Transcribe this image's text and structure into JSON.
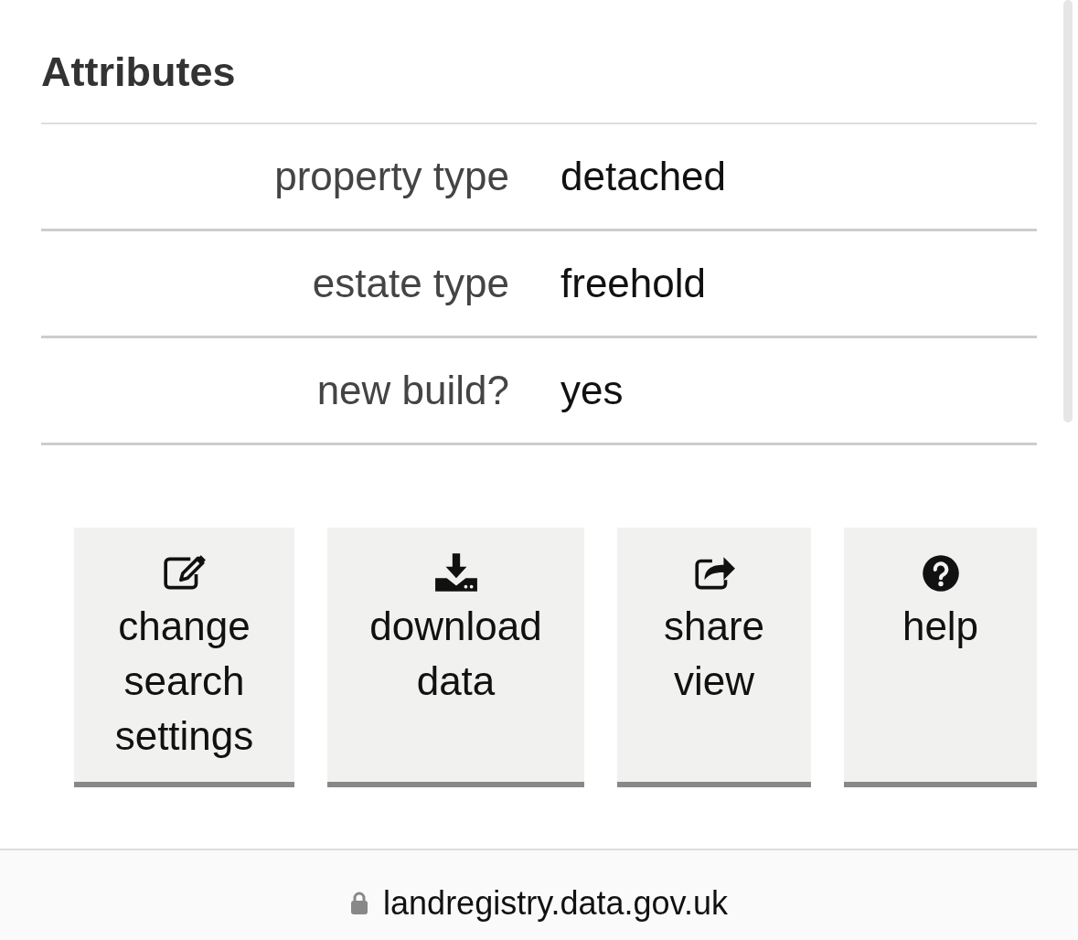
{
  "section": {
    "title": "Attributes"
  },
  "attributes": [
    {
      "label": "property type",
      "value": "detached"
    },
    {
      "label": "estate type",
      "value": "freehold"
    },
    {
      "label": "new build?",
      "value": "yes"
    }
  ],
  "buttons": [
    {
      "kind": "edit",
      "label": "change search settings"
    },
    {
      "kind": "download",
      "label": "download data"
    },
    {
      "kind": "share",
      "label": "share view"
    },
    {
      "kind": "help",
      "label": "help"
    }
  ],
  "address_bar": {
    "url": "landregistry.data.gov.uk"
  }
}
